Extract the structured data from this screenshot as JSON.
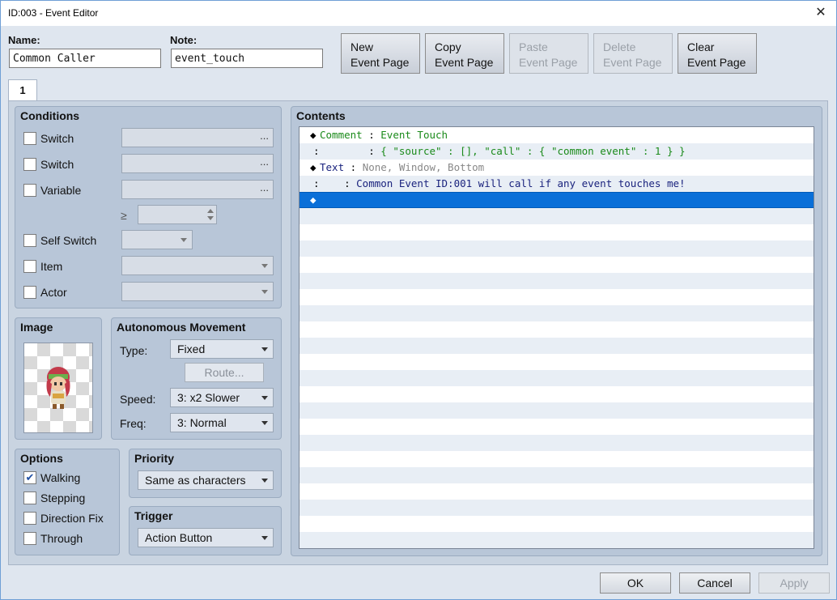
{
  "window": {
    "title": "ID:003 - Event Editor"
  },
  "fields": {
    "name_label": "Name:",
    "name_value": "Common Caller",
    "note_label": "Note:",
    "note_value": "event_touch"
  },
  "page_buttons": {
    "new": [
      "New",
      "Event Page"
    ],
    "copy": [
      "Copy",
      "Event Page"
    ],
    "paste": [
      "Paste",
      "Event Page"
    ],
    "delete": [
      "Delete",
      "Event Page"
    ],
    "clear": [
      "Clear",
      "Event Page"
    ]
  },
  "tabs": [
    {
      "label": "1"
    }
  ],
  "conditions": {
    "title": "Conditions",
    "switch1": "Switch",
    "switch2": "Switch",
    "variable": "Variable",
    "ge": "≥",
    "self_switch": "Self Switch",
    "item": "Item",
    "actor": "Actor",
    "ellipsis": "..."
  },
  "image": {
    "title": "Image"
  },
  "movement": {
    "title": "Autonomous Movement",
    "type_label": "Type:",
    "type_value": "Fixed",
    "route_button": "Route...",
    "speed_label": "Speed:",
    "speed_value": "3: x2 Slower",
    "freq_label": "Freq:",
    "freq_value": "3: Normal"
  },
  "options": {
    "title": "Options",
    "walking": "Walking",
    "stepping": "Stepping",
    "direction_fix": "Direction Fix",
    "through": "Through",
    "walking_checked": "✔"
  },
  "priority": {
    "title": "Priority",
    "value": "Same as characters"
  },
  "trigger": {
    "title": "Trigger",
    "value": "Action Button"
  },
  "contents": {
    "title": "Contents",
    "lines": [
      {
        "lead": "◆",
        "cmd": "Comment",
        "sep": " : ",
        "text": "Event Touch"
      },
      {
        "lead": ":",
        "cmd": "",
        "sep": "        : ",
        "text": "{ \"source\" : [], \"call\" : { \"common event\" : 1 } }"
      },
      {
        "lead": "◆",
        "cmd": "Text",
        "sep": " : ",
        "text": "None, Window, Bottom"
      },
      {
        "lead": ":",
        "cmd": "",
        "sep": "    : ",
        "text": "Common Event ID:001 will call if any event touches me!"
      },
      {
        "lead": "◆",
        "cmd": "",
        "sep": "",
        "text": ""
      }
    ]
  },
  "footer": {
    "ok": "OK",
    "cancel": "Cancel",
    "apply": "Apply"
  },
  "icons": {
    "close": "✕"
  }
}
